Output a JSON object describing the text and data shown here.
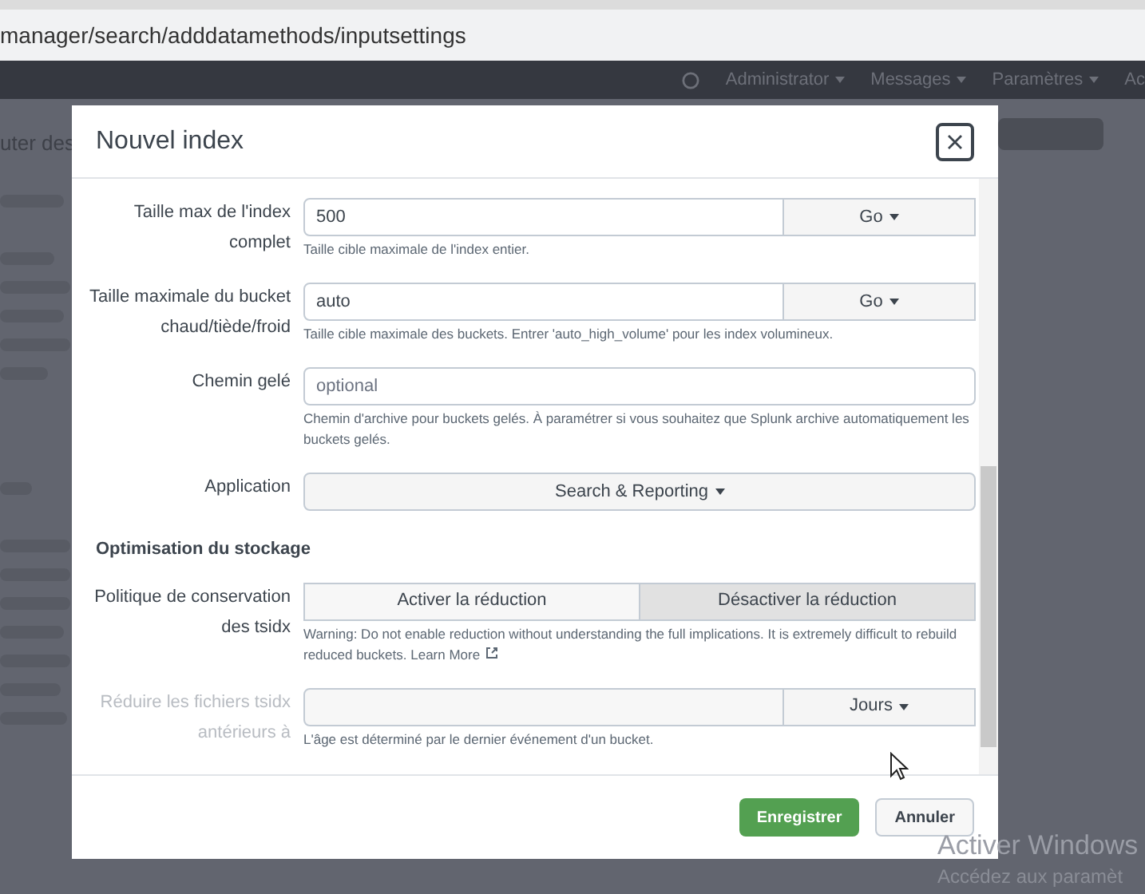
{
  "browser": {
    "url": "manager/search/adddatamethods/inputsettings"
  },
  "navbar": {
    "items": [
      {
        "label": "Administrator",
        "kind": "menu"
      },
      {
        "label": "Messages",
        "kind": "menu"
      },
      {
        "label": "Paramètres",
        "kind": "menu"
      },
      {
        "label": "Ac",
        "kind": "plain"
      }
    ]
  },
  "background": {
    "heading_fragment": "uter des"
  },
  "dialog": {
    "title": "Nouvel index",
    "fields": [
      {
        "kind": "size",
        "label": "Taille max de l'index complet",
        "value": "500",
        "unit": "Go",
        "help": "Taille cible maximale de l'index entier.",
        "disabled": false
      },
      {
        "kind": "size",
        "label": "Taille maximale du bucket chaud/tiède/froid",
        "value": "auto",
        "unit": "Go",
        "help": "Taille cible maximale des buckets. Entrer 'auto_high_volume' pour les index volumineux.",
        "disabled": false
      },
      {
        "kind": "text",
        "label": "Chemin gelé",
        "placeholder": "optional",
        "help": "Chemin d'archive pour buckets gelés. À paramétrer si vous souhaitez que Splunk archive automatiquement les buckets gelés."
      },
      {
        "kind": "select",
        "label": "Application",
        "value": "Search & Reporting"
      },
      {
        "kind": "section",
        "label": "Optimisation du stockage"
      },
      {
        "kind": "toggle",
        "label": "Politique de conservation des tsidx",
        "options": [
          {
            "label": "Activer la réduction",
            "selected": false
          },
          {
            "label": "Désactiver la réduction",
            "selected": true
          }
        ],
        "help": "Warning: Do not enable reduction without understanding the full implications. It is extremely difficult to rebuild reduced buckets.",
        "link": "Learn More"
      },
      {
        "kind": "size",
        "label": "Réduire les fichiers tsidx antérieurs à",
        "unit": "Jours",
        "help": "L'âge est déterminé par le dernier événement d'un bucket.",
        "disabled": true
      }
    ],
    "buttons": [
      {
        "label": "Enregistrer",
        "kind": "primary"
      },
      {
        "label": "Annuler",
        "kind": "secondary"
      }
    ]
  },
  "os_notice": {
    "title": "Activer Windows",
    "subtitle": "Accédez aux paramèt"
  }
}
